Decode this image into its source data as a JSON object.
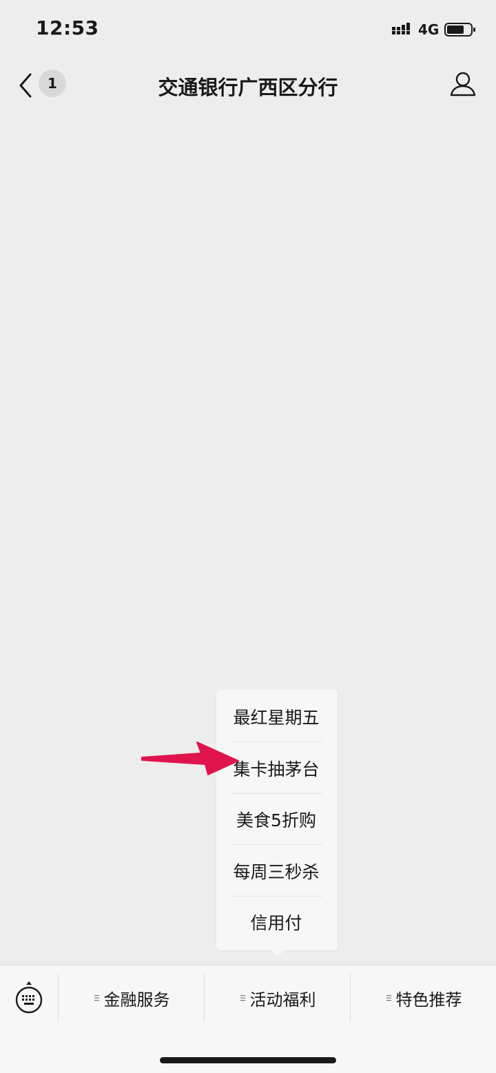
{
  "status_bar": {
    "time": "12:53",
    "network": "4G",
    "icons": [
      "signal-icon",
      "battery-icon"
    ]
  },
  "nav": {
    "back_icon": "back-chevron-icon",
    "unread_count": "1",
    "title": "交通银行广西区分行",
    "profile_icon": "person-icon"
  },
  "popup_menu": {
    "items": [
      "最红星期五",
      "集卡抽茅台",
      "美食5折购",
      "每周三秒杀",
      "信用付"
    ]
  },
  "annotation": {
    "arrow_color": "#e0144c",
    "points_to": "集卡抽茅台"
  },
  "bottom_menu": {
    "keyboard_icon": "keyboard-icon",
    "tabs": [
      {
        "label": "金融服务",
        "icon": "menu-lines-icon"
      },
      {
        "label": "活动福利",
        "icon": "menu-lines-icon"
      },
      {
        "label": "特色推荐",
        "icon": "menu-lines-icon"
      }
    ]
  }
}
